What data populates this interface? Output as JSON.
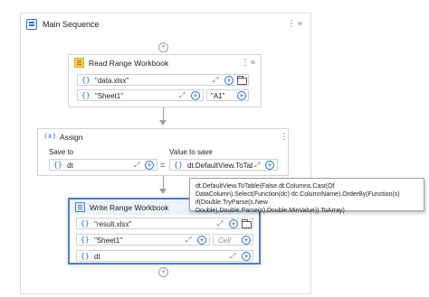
{
  "sequence": {
    "title": "Main Sequence"
  },
  "read_range": {
    "title": "Read Range Workbook",
    "path_value": "\"data.xlsx\"",
    "sheet_value": "\"Sheet1\"",
    "range_value": "\"A1\""
  },
  "assign": {
    "title": "Assign",
    "save_to_label": "Save to",
    "value_label": "Value to save",
    "save_to_value": "dt",
    "value_value": "dt.DefaultView.ToTable"
  },
  "tooltip": {
    "text": "dt.DefaultView.ToTable(False,dt.Columns.Cast(Of DataColumn).Select(Function(dc) dc.ColumnName).OrderBy(Function(s) if(Double.TryParse(s,New Double),Double.Parse(s),Double.MinValue)).ToArray)"
  },
  "write_range": {
    "title": "Write Range Workbook",
    "path_value": "\"result.xlsx\"",
    "sheet_value": "\"Sheet1\"",
    "cell_placeholder": "Cell",
    "data_value": "dt"
  },
  "glyphs": {
    "brace": "{}",
    "assign_icon": "(x)",
    "plus": "+",
    "kebab": "⋮",
    "collapse": "≈",
    "expand": "⤢",
    "equals": "="
  }
}
